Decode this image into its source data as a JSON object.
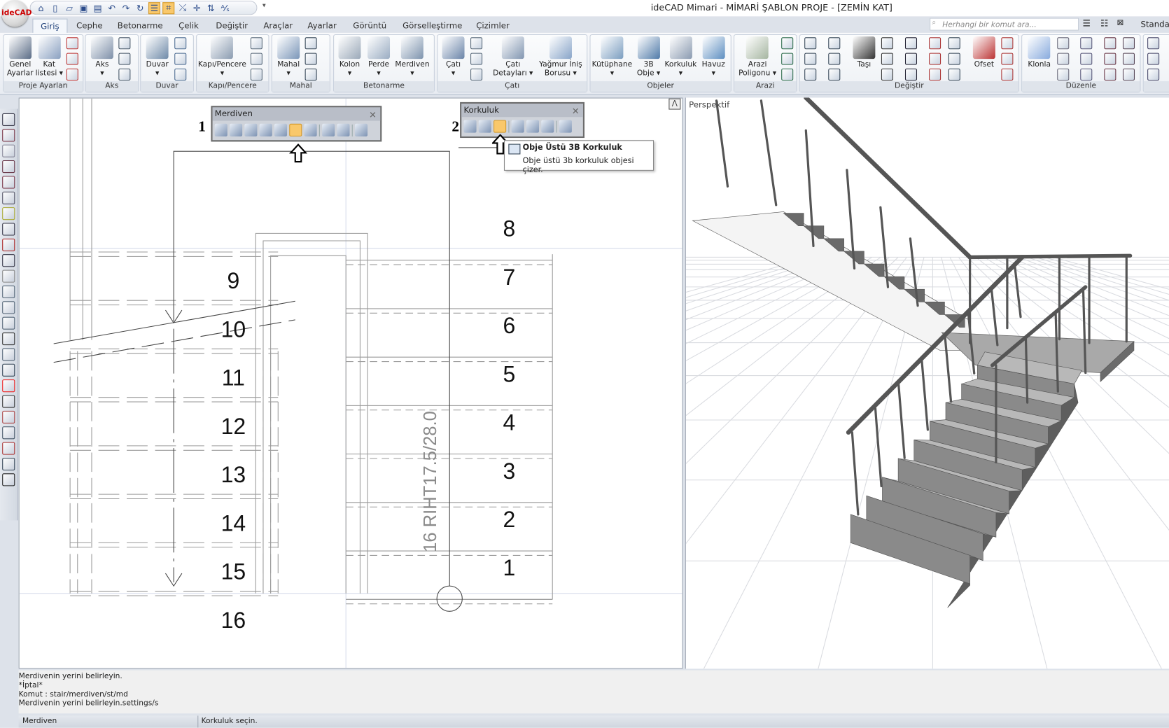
{
  "window": {
    "title": "ideCAD Mimari - MİMARİ ŞABLON PROJE - [ZEMİN KAT]",
    "logo_text": "ideCAD"
  },
  "quick_access": [
    "home-icon",
    "new-file-icon",
    "open-folder-icon",
    "save-icon",
    "save-all-icon",
    "undo-icon",
    "redo-icon",
    "refresh-icon",
    "layers-toggle-icon",
    "snap-toggle-icon",
    "snap-perpendicular-icon",
    "snap-intersection-icon",
    "snap-extension-icon",
    "text-style-icon"
  ],
  "quick_access_more": "▾",
  "tabs": [
    {
      "label": "Giriş",
      "active": true
    },
    {
      "label": "Cephe"
    },
    {
      "label": "Betonarme"
    },
    {
      "label": "Çelik"
    },
    {
      "label": "Değiştir"
    },
    {
      "label": "Araçlar"
    },
    {
      "label": "Ayarlar"
    },
    {
      "label": "Görüntü"
    },
    {
      "label": "Görselleştirme"
    },
    {
      "label": "Çizimler"
    }
  ],
  "search": {
    "placeholder": "Herhangi bir komut ara..."
  },
  "style_selector": "Standar",
  "ribbon": {
    "groups": [
      "Proje Ayarları",
      "Aks",
      "Duvar",
      "Kapı/Pencere",
      "Mahal",
      "Betonarme",
      "Çatı",
      "Objeler",
      "Arazi",
      "Değiştir",
      "Düzenle",
      ""
    ],
    "buttons": [
      {
        "label": "Genel\nAyarlar",
        "icon": "tools-icon"
      },
      {
        "label": "Kat\nlistesi ▾",
        "icon": "floor-list-icon"
      },
      {
        "label": "Aks\n▾",
        "icon": "axis-icon"
      },
      {
        "label": "Duvar\n▾",
        "icon": "wall-icon"
      },
      {
        "label": "Kapı/Pencere\n▾",
        "icon": "door-icon"
      },
      {
        "label": "Mahal\n▾",
        "icon": "room-icon"
      },
      {
        "label": "Kolon\n▾",
        "icon": "column-icon"
      },
      {
        "label": "Perde\n▾",
        "icon": "shear-wall-icon"
      },
      {
        "label": "Merdiven\n▾",
        "icon": "stair-icon"
      },
      {
        "label": "Çatı\n▾",
        "icon": "roof-icon"
      },
      {
        "label": "Çatı\nDetayları ▾",
        "icon": "roof-detail-icon"
      },
      {
        "label": "Yağmur İniş\nBorusu ▾",
        "icon": "downpipe-icon"
      },
      {
        "label": "Kütüphane\n▾",
        "icon": "library-icon"
      },
      {
        "label": "3B\nObje ▾",
        "icon": "3d-object-icon"
      },
      {
        "label": "Korkuluk\n▾",
        "icon": "railing-icon"
      },
      {
        "label": "Havuz\n▾",
        "icon": "pool-icon"
      },
      {
        "label": "Arazi\nPoligonu ▾",
        "icon": "terrain-icon"
      },
      {
        "label": "Taşı",
        "icon": "move-icon"
      },
      {
        "label": "Ofset",
        "icon": "offset-icon"
      },
      {
        "label": "Klonla",
        "icon": "clone-icon"
      }
    ]
  },
  "left_toolbar": [
    "select-rectangle-icon",
    "select-objects-icon",
    "deselect-icon",
    "move-floor-icon",
    "split-icon",
    "select-grid-icon",
    "measure-icon",
    "properties-icon",
    "floor-icon",
    "copy-icon",
    "paste-icon",
    "clone-icon",
    "copy-floor-icon",
    "mirror-icon",
    "array-icon",
    "section-icon",
    "dimension-icon",
    "elevation-icon",
    "line-icon",
    "hammer-icon",
    "corner-icon",
    "render-icon",
    "auto-text-icon",
    "binoculars-icon"
  ],
  "floating_toolbars": {
    "merdiven": {
      "title": "Merdiven",
      "callout": "1",
      "icons": [
        "straight-stair-icon",
        "green-stair-icon",
        "add-stair-icon",
        "stair-select-icon",
        "stair-edit-icon",
        "stair-numbering-icon",
        "stair-table-icon",
        "stair-grid-icon",
        "stair-half-icon",
        "stair-settings-icon"
      ],
      "active": "stair-numbering-icon"
    },
    "korkuluk": {
      "title": "Korkuluk",
      "callout": "2",
      "icons": [
        "railing-icon",
        "railing-stair-icon",
        "object-railing-icon",
        "railing-raise-icon",
        "railing-check-icon",
        "railing-span-icon",
        "railing-settings-icon"
      ],
      "active": "object-railing-icon"
    }
  },
  "tooltip": {
    "title": "Obje Üstü 3B Korkuluk",
    "description": "Obje üstü 3b korkuluk objesi çizer."
  },
  "plan": {
    "left_steps": [
      "9",
      "10",
      "11",
      "12",
      "13",
      "14",
      "15",
      "16"
    ],
    "right_steps": [
      "8",
      "7",
      "6",
      "5",
      "4",
      "3",
      "2",
      "1"
    ],
    "stair_label": "16 RIHT17.5/28.0"
  },
  "view3d": {
    "label": "Perspektif"
  },
  "command_log": [
    "Merdivenin yerini belirleyin.",
    "*İptal*",
    "Komut : stair/merdiven/st/md",
    "Merdivenin yerini belirleyin.settings/s"
  ],
  "status": {
    "left": "Merdiven",
    "right": "Korkuluk seçin."
  },
  "colors": {
    "highlight": "#f9c86b",
    "ribbon_bg": "#f8f9fb",
    "tab_active": "#1e3f78"
  }
}
